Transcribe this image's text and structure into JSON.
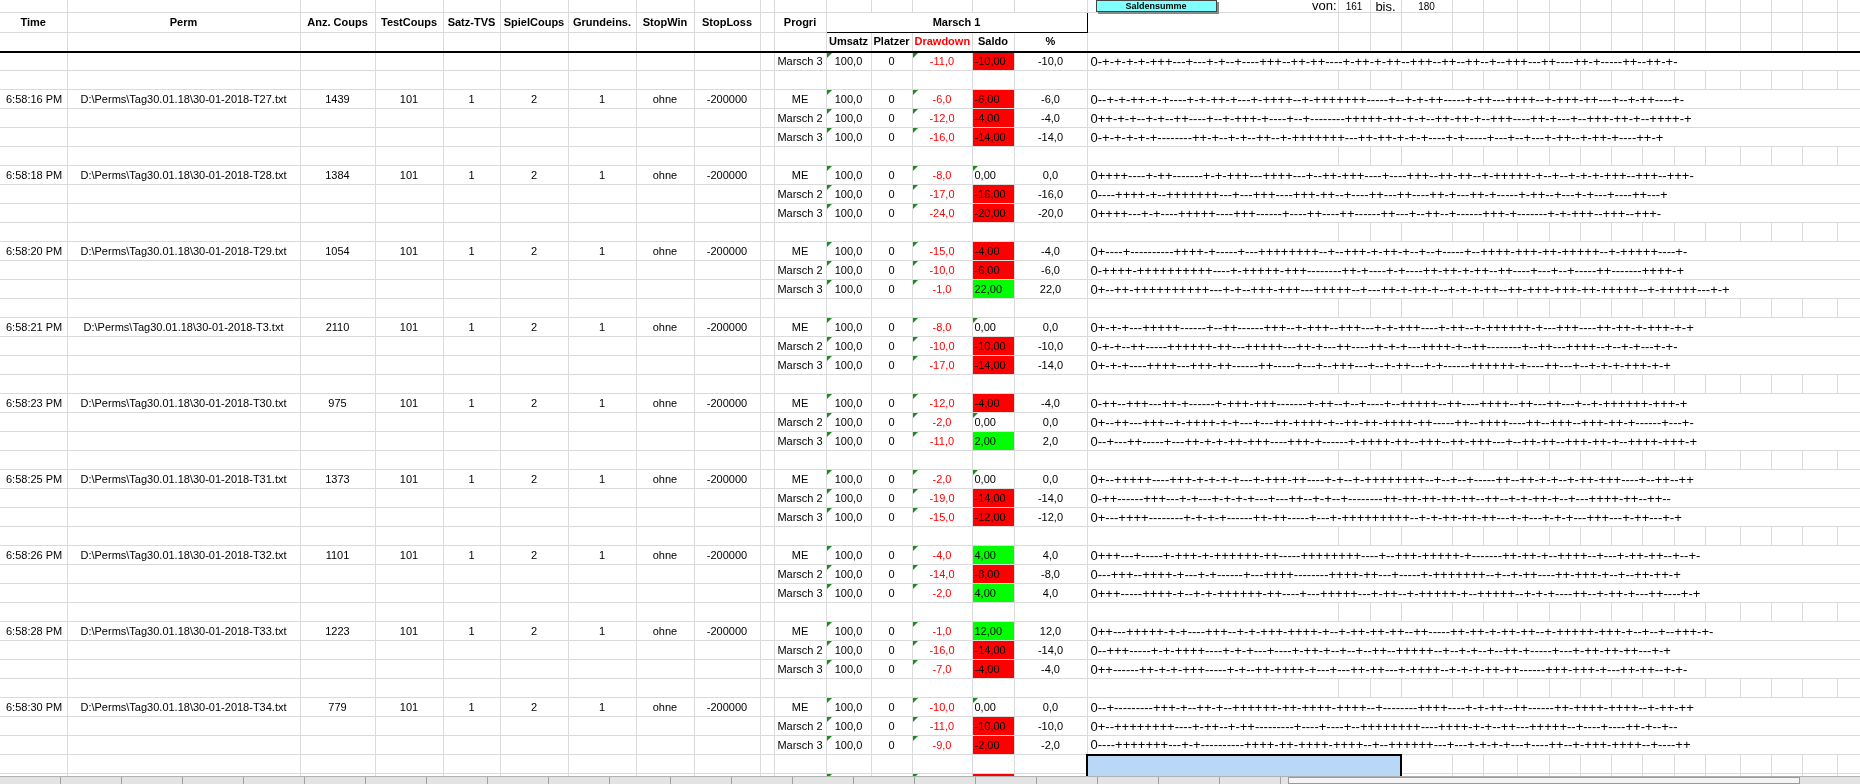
{
  "button": {
    "label": "Saldensumme"
  },
  "range": {
    "from_label": "von:",
    "from": "161",
    "to_label": "bis.",
    "to": "180"
  },
  "columns": [
    "Time",
    "Perm",
    "Anz. Coups",
    "TestCoups",
    "Satz-TVS",
    "SpielCoups",
    "Grundeins.",
    "StopWin",
    "StopLoss"
  ],
  "progri_header": "Progri",
  "group_header": "Marsch 1",
  "sub_columns": [
    {
      "label": "Umsatz",
      "kind": "plain"
    },
    {
      "label": "Platzer",
      "kind": "plain"
    },
    {
      "label": "Drawdown",
      "kind": "alert"
    },
    {
      "label": "Saldo",
      "kind": "plain"
    },
    {
      "label": "%",
      "kind": "plain"
    }
  ],
  "groups": [
    {
      "rows": [
        {
          "progri": "Marsch 3",
          "umsatz": "100,0",
          "platzer": "0",
          "drawdown": "-11,0",
          "saldo": "-10,00",
          "color": "#ff0000",
          "percent": "-10,0",
          "sequence": "0-+-+-+-+-+++---+---+-+--+----+++--++-++----+-++-+-++--+++--++--++--+--+++---++----++-+-----++--++-+-"
        }
      ]
    },
    {
      "cells": [
        "6:58:16 PM",
        "D:\\Perms\\Tag30.01.18\\30-01-2018-T27.txt",
        "1439",
        "101",
        "1",
        "2",
        "1",
        "ohne",
        "-200000"
      ],
      "rows": [
        {
          "progri": "ME",
          "umsatz": "100,0",
          "platzer": "0",
          "drawdown": "-6,0",
          "saldo": "-6,00",
          "color": "#ff0000",
          "percent": "-6,0",
          "sequence": "0--+-+-++-+-+----+-+-++-+---+-++++--+-+++++++-----+--+-+-++-----+-++---++++--+-+++-++---+--+-++----+-"
        },
        {
          "progri": "Marsch 2",
          "umsatz": "100,0",
          "platzer": "0",
          "drawdown": "-12,0",
          "saldo": "-4,00",
          "color": "#ff0000",
          "percent": "-4,0",
          "sequence": "0++-+-+--+-+--++----+--+-+++-+----+--+--------+++++-++-+-+--++-++-+--+++----++-+---+--+++-++-+--++++-+"
        },
        {
          "progri": "Marsch 3",
          "umsatz": "100,0",
          "platzer": "0",
          "drawdown": "-16,0",
          "saldo": "-14,00",
          "color": "#ff0000",
          "percent": "-14,0",
          "sequence": "0-+-+-+-+-+--------++-+--+-+--++--+-+++++++---++-++-+-+-+----+-+-----+---+--+---+-++--+-++-+----++-+"
        }
      ]
    },
    {
      "cells": [
        "6:58:18 PM",
        "D:\\Perms\\Tag30.01.18\\30-01-2018-T28.txt",
        "1384",
        "101",
        "1",
        "2",
        "1",
        "ohne",
        "-200000"
      ],
      "rows": [
        {
          "progri": "ME",
          "umsatz": "100,0",
          "platzer": "0",
          "drawdown": "-8,0",
          "saldo": "0,00",
          "percent": "0,0",
          "sequence": "0++++----+-++-------+-+-+++---++++---+--++-+++----+----+++--++-++--+-+++++-+--+--+-+-+-+++--+++--+++-"
        },
        {
          "progri": "Marsch 2",
          "umsatz": "100,0",
          "platzer": "0",
          "drawdown": "-17,0",
          "saldo": "-16,00",
          "color": "#ff0000",
          "percent": "-16,0",
          "sequence": "0----++++-+--+++++++---+---+++----+++-++--+----++---++----++-+---++-+-----+-++--+---+-+---+----++---+"
        },
        {
          "progri": "Marsch 3",
          "umsatz": "100,0",
          "platzer": "0",
          "drawdown": "-24,0",
          "saldo": "-20,00",
          "color": "#ff0000",
          "percent": "-20,0",
          "sequence": "0++++---+-+----+++++----+++------+----++----++------++---+--++--+------+++-+-------+-+-+++--+++--+++-"
        }
      ]
    },
    {
      "cells": [
        "6:58:20 PM",
        "D:\\Perms\\Tag30.01.18\\30-01-2018-T29.txt",
        "1054",
        "101",
        "1",
        "2",
        "1",
        "ohne",
        "-200000"
      ],
      "rows": [
        {
          "progri": "ME",
          "umsatz": "100,0",
          "platzer": "0",
          "drawdown": "-15,0",
          "saldo": "-4,00",
          "color": "#ff0000",
          "percent": "-4,0",
          "sequence": "0+----+----------++++-+-----+---++++++++--+--+++-+-++-+--+--+-----+--++++-+++-++-+++++--+-+++++----+-"
        },
        {
          "progri": "Marsch 2",
          "umsatz": "100,0",
          "platzer": "0",
          "drawdown": "-10,0",
          "saldo": "-6,00",
          "color": "#ff0000",
          "percent": "-6,0",
          "sequence": "0-++++-++++++++++----+-+++++-+++--------++-+----+-+----++-++-+-++--++----+---+--+-----++-------++++-+"
        },
        {
          "progri": "Marsch 3",
          "umsatz": "100,0",
          "platzer": "0",
          "drawdown": "-1,0",
          "saldo": "22,00",
          "color": "#00ff00",
          "percent": "22,0",
          "sequence": "0+--++-++++++++++---+-+--+++-+++---+++++--+---++-+-++-+--+-+-+-++--++-+++-+++-++-+++++--+-+++++---+-+"
        }
      ]
    },
    {
      "cells": [
        "6:58:21 PM",
        "D:\\Perms\\Tag30.01.18\\30-01-2018-T3.txt",
        "2110",
        "101",
        "1",
        "2",
        "1",
        "ohne",
        "-200000"
      ],
      "rows": [
        {
          "progri": "ME",
          "umsatz": "100,0",
          "platzer": "0",
          "drawdown": "-8,0",
          "saldo": "0,00",
          "percent": "0,0",
          "sequence": "0+-+-+---+++++------+--++------+++--+-+++--+++---+-+-+++----+-++--+-++++++-+---+++----++-++-+-+++-+-+"
        },
        {
          "progri": "Marsch 2",
          "umsatz": "100,0",
          "platzer": "0",
          "drawdown": "-10,0",
          "saldo": "-10,00",
          "color": "#ff0000",
          "percent": "-10,0",
          "sequence": "0-+-+--++-----++++++-++---+++++---++-+---++----++-+-+---++++-+--++--------+--++---++++--+--+-+---+-+-"
        },
        {
          "progri": "Marsch 3",
          "umsatz": "100,0",
          "platzer": "0",
          "drawdown": "-17,0",
          "saldo": "-14,00",
          "color": "#ff0000",
          "percent": "-14,0",
          "sequence": "0+-+-+----++++---+++-++------++-----+---+--+++---+--+-++---+-+------++++++-+----++---+--+-+-+-+++-+-+"
        }
      ]
    },
    {
      "cells": [
        "6:58:23 PM",
        "D:\\Perms\\Tag30.01.18\\30-01-2018-T30.txt",
        "975",
        "101",
        "1",
        "2",
        "1",
        "ohne",
        "-200000"
      ],
      "rows": [
        {
          "progri": "ME",
          "umsatz": "100,0",
          "platzer": "0",
          "drawdown": "-12,0",
          "saldo": "-4,00",
          "color": "#ff0000",
          "percent": "-4,0",
          "sequence": "0-++--+++---++-+------+-+++-+++-------+-++--+--+----+--+++++--++----++++--++---++---+--+-++++++-+++-+"
        },
        {
          "progri": "Marsch 2",
          "umsatz": "100,0",
          "platzer": "0",
          "drawdown": "-2,0",
          "saldo": "0,00",
          "percent": "0,0",
          "sequence": "0+--++---+++--+-++++-+-+---+---++-++++-+--++-++-++++-++-----++--++++----++--+++--+++-++-+------+---+-"
        },
        {
          "progri": "Marsch 3",
          "umsatz": "100,0",
          "platzer": "0",
          "drawdown": "-11,0",
          "saldo": "2,00",
          "color": "#00ff00",
          "percent": "2,0",
          "sequence": "0--+---++-----+---++-+-+-++-+++----+++-+------+-++++-++--+++--++-+++---+--++-++--+++-++-+--++++-+++-+"
        }
      ]
    },
    {
      "cells": [
        "6:58:25 PM",
        "D:\\Perms\\Tag30.01.18\\30-01-2018-T31.txt",
        "1373",
        "101",
        "1",
        "2",
        "1",
        "ohne",
        "-200000"
      ],
      "rows": [
        {
          "progri": "ME",
          "umsatz": "100,0",
          "platzer": "0",
          "drawdown": "-2,0",
          "saldo": "0,00",
          "percent": "0,0",
          "sequence": "0+--+++++----+++-+-+-+-+---+-+++-++----+-+--+-++++++++--+--+--+-----++--++-+-+--+-++-+++----+--++--++"
        },
        {
          "progri": "Marsch 2",
          "umsatz": "100,0",
          "platzer": "0",
          "drawdown": "-19,0",
          "saldo": "-14,00",
          "color": "#ff0000",
          "percent": "-14,0",
          "sequence": "0-++------+++---+-+---+-+-+-+---+---++--+-+--+--------++-++-++-++-++--++--+-+-++-+--+---++++-++--++--"
        },
        {
          "progri": "Marsch 3",
          "umsatz": "100,0",
          "platzer": "0",
          "drawdown": "-15,0",
          "saldo": "-12,00",
          "color": "#ff0000",
          "percent": "-12,0",
          "sequence": "0+---++++--------+-+-+-+------++-++-----+---+-+++++++++--+-+-++-++-++---+-+---+-+-+---+++---+-++---+-+"
        }
      ]
    },
    {
      "cells": [
        "6:58:26 PM",
        "D:\\Perms\\Tag30.01.18\\30-01-2018-T32.txt",
        "1101",
        "101",
        "1",
        "2",
        "1",
        "ohne",
        "-200000"
      ],
      "rows": [
        {
          "progri": "ME",
          "umsatz": "100,0",
          "platzer": "0",
          "drawdown": "-4,0",
          "saldo": "4,00",
          "color": "#00ff00",
          "percent": "4,0",
          "sequence": "0+++---+-----+-+++-+-++++++-++-----++++++++----+--+++-+++++-+-------++-++-+--++++--+---+-++-++--+--+-"
        },
        {
          "progri": "Marsch 2",
          "umsatz": "100,0",
          "platzer": "0",
          "drawdown": "-14,0",
          "saldo": "-8,00",
          "color": "#ff0000",
          "percent": "-8,0",
          "sequence": "0---+++--++++-+---+-+------+---++++--------++++-++---+-----+-+++++++--+--+-++----++-+++-+--+--++-++-+"
        },
        {
          "progri": "Marsch 3",
          "umsatz": "100,0",
          "platzer": "0",
          "drawdown": "-2,0",
          "saldo": "4,00",
          "color": "#00ff00",
          "percent": "4,0",
          "sequence": "0+++-----++++-+--+-+-++++++-++----+---+++++---+-++--+-+++++-+--+++++--+-+-+----++--+-++-+---++----+-+"
        }
      ]
    },
    {
      "cells": [
        "6:58:28 PM",
        "D:\\Perms\\Tag30.01.18\\30-01-2018-T33.txt",
        "1223",
        "101",
        "1",
        "2",
        "1",
        "ohne",
        "-200000"
      ],
      "rows": [
        {
          "progri": "ME",
          "umsatz": "100,0",
          "platzer": "0",
          "drawdown": "-1,0",
          "saldo": "12,00",
          "color": "#00ff00",
          "percent": "12,0",
          "sequence": "0++---+++++-+-+----+++--+-+-+++-++++-+--+-++-++-++--++-----++-++-+-++-++--+-+++++-+++-+--+--+--+++-+-"
        },
        {
          "progri": "Marsch 2",
          "umsatz": "100,0",
          "platzer": "0",
          "drawdown": "-16,0",
          "saldo": "-14,00",
          "color": "#ff0000",
          "percent": "-14,0",
          "sequence": "0--+++-----+-+-++++----+-+-+---+----+-++-+--+--+--++--+++++--+--+-+--+--++-+-----+---+-++-++-++---+-+"
        },
        {
          "progri": "Marsch 3",
          "umsatz": "100,0",
          "platzer": "0",
          "drawdown": "-7,0",
          "saldo": "-4,00",
          "color": "#ff0000",
          "percent": "-4,0",
          "sequence": "0++------++-+-+-+++-----+-+--++-++++-+---+---++-++---+-++++--+-+-+-++-++------+++-+++-+---++-++--+-+-"
        }
      ]
    },
    {
      "cells": [
        "6:58:30 PM",
        "D:\\Perms\\Tag30.01.18\\30-01-2018-T34.txt",
        "779",
        "101",
        "1",
        "2",
        "1",
        "ohne",
        "-200000"
      ],
      "rows": [
        {
          "progri": "ME",
          "umsatz": "100,0",
          "platzer": "0",
          "drawdown": "-10,0",
          "saldo": "0,00",
          "percent": "0,0",
          "sequence": "0--+---------+++-+--++-+--++++++-++-++++-++++--+--------++++----+-+-++--++------++-++++-++++--+-++-++"
        },
        {
          "progri": "Marsch 2",
          "umsatz": "100,0",
          "platzer": "0",
          "drawdown": "-11,0",
          "saldo": "-10,00",
          "color": "#ff0000",
          "percent": "-10,0",
          "sequence": "0+--++++++++----+-++--+-++---------+----+----+--++++++++----++++-+-+--++---+++++--+----+----++-+--+--"
        },
        {
          "progri": "Marsch 3",
          "umsatz": "100,0",
          "platzer": "0",
          "drawdown": "-9,0",
          "saldo": "-2,00",
          "color": "#ff0000",
          "percent": "-2,0",
          "sequence": "0----+++++++---+-+----------++++-++-++++-++++--+--++++++---+---+-+-+-+---+----++--+-+++-++++--+----++"
        }
      ]
    },
    {
      "rows": [
        {
          "color": "#ff0000"
        }
      ]
    }
  ],
  "cell_selection": true
}
